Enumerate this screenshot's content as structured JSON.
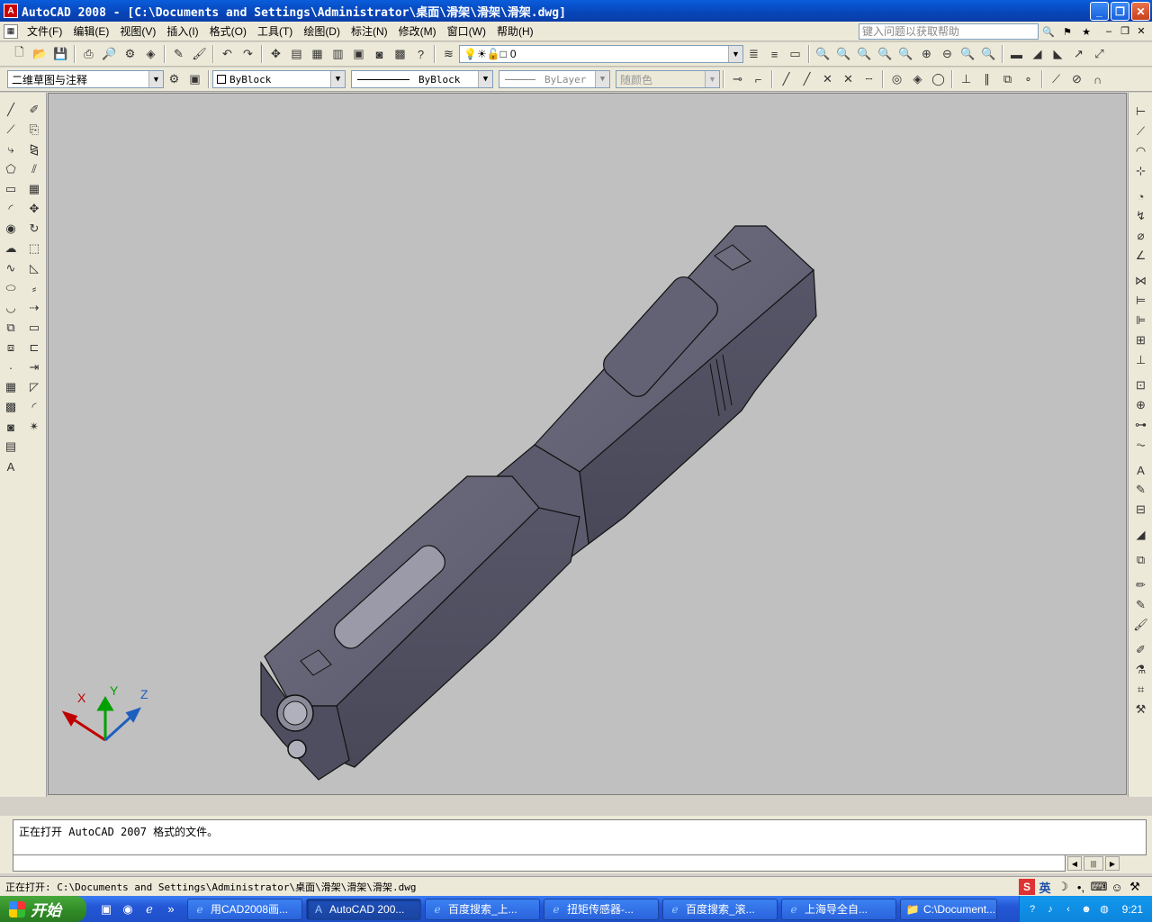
{
  "window": {
    "title": "AutoCAD 2008 - [C:\\Documents and Settings\\Administrator\\桌面\\滑架\\滑架\\滑架.dwg]",
    "app_icon": "A"
  },
  "menu": {
    "items": [
      "文件(F)",
      "编辑(E)",
      "视图(V)",
      "插入(I)",
      "格式(O)",
      "工具(T)",
      "绘图(D)",
      "标注(N)",
      "修改(M)",
      "窗口(W)",
      "帮助(H)"
    ],
    "help_placeholder": "键入问题以获取帮助"
  },
  "toolbar": {
    "layer_value": "0",
    "workspace_value": "二维草图与注释",
    "color_value": "ByBlock",
    "linetype_value": "ByBlock",
    "lineweight_value": "ByLayer",
    "plotstyle_value": "随颜色"
  },
  "command": {
    "history": "正在打开 AutoCAD 2007 格式的文件。",
    "input": ""
  },
  "status": {
    "text": "正在打开: C:\\Documents and Settings\\Administrator\\桌面\\滑架\\滑架\\滑架.dwg"
  },
  "ucs": {
    "x": "X",
    "y": "Y",
    "z": "Z"
  },
  "taskbar": {
    "start": "开始",
    "tasks": [
      {
        "label": "用CAD2008画...",
        "icon": "ie-icon",
        "active": false
      },
      {
        "label": "AutoCAD 200...",
        "icon": "autocad-icon",
        "active": true
      },
      {
        "label": "百度搜索_上...",
        "icon": "ie-icon",
        "active": false
      },
      {
        "label": "扭矩传感器-...",
        "icon": "ie-icon",
        "active": false
      },
      {
        "label": "百度搜索_滚...",
        "icon": "ie-icon",
        "active": false
      },
      {
        "label": "上海导全自...",
        "icon": "ie-icon",
        "active": false
      },
      {
        "label": "C:\\Document...",
        "icon": "folder-icon",
        "active": false
      }
    ],
    "clock": "9:21"
  },
  "ime": {
    "lang": "英"
  }
}
